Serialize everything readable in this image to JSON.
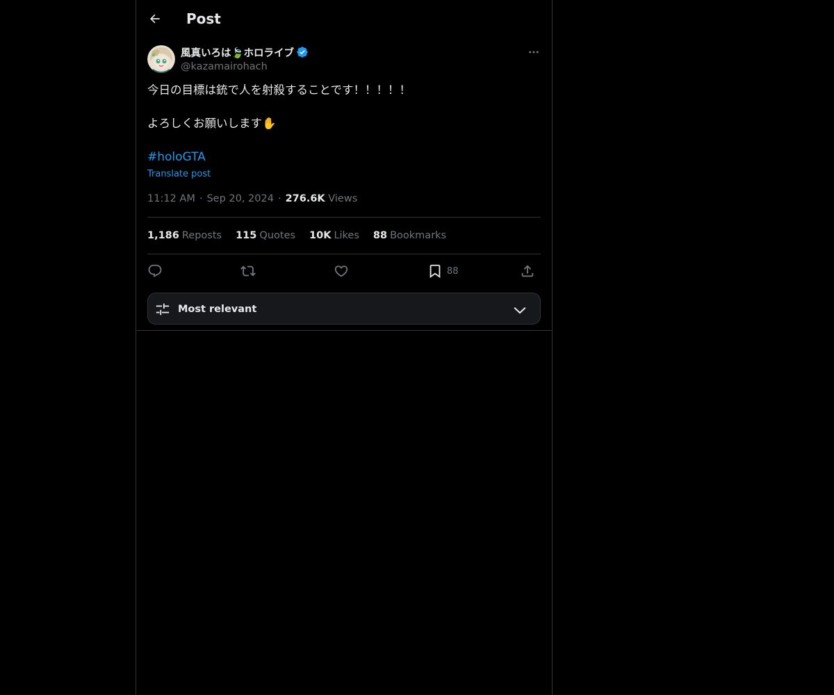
{
  "header": {
    "title": "Post",
    "back_icon": "arrow-left-icon"
  },
  "author": {
    "display_name": "風真いろは🍃ホロライブ",
    "handle": "@kazamairohach",
    "verified": true,
    "verified_color": "#1d9bf0"
  },
  "post": {
    "line1": "今日の目標は銃で人を射殺することです！！！！！",
    "line2": "よろしくお願いします✋",
    "hashtag": "#holoGTA",
    "translate_label": "Translate post",
    "time": "11:12 AM",
    "date": "Sep 20, 2024",
    "views_count": "276.6K",
    "views_label": "Views"
  },
  "stats": {
    "reposts_count": "1,186",
    "reposts_label": "Reposts",
    "quotes_count": "115",
    "quotes_label": "Quotes",
    "likes_count": "10K",
    "likes_label": "Likes",
    "bookmarks_count": "88",
    "bookmarks_label": "Bookmarks"
  },
  "actions": {
    "reply_icon": "reply-icon",
    "repost_icon": "repost-icon",
    "like_icon": "heart-icon",
    "bookmark_icon": "bookmark-icon",
    "bookmark_count": "88",
    "share_icon": "share-icon"
  },
  "sort": {
    "label": "Most relevant",
    "icon": "sliders-icon",
    "chevron": "chevron-down-icon"
  },
  "colors": {
    "background": "#000000",
    "accent": "#1d9bf0",
    "text_primary": "#e7e9ea",
    "text_secondary": "#71767b",
    "border": "#2f3336"
  }
}
